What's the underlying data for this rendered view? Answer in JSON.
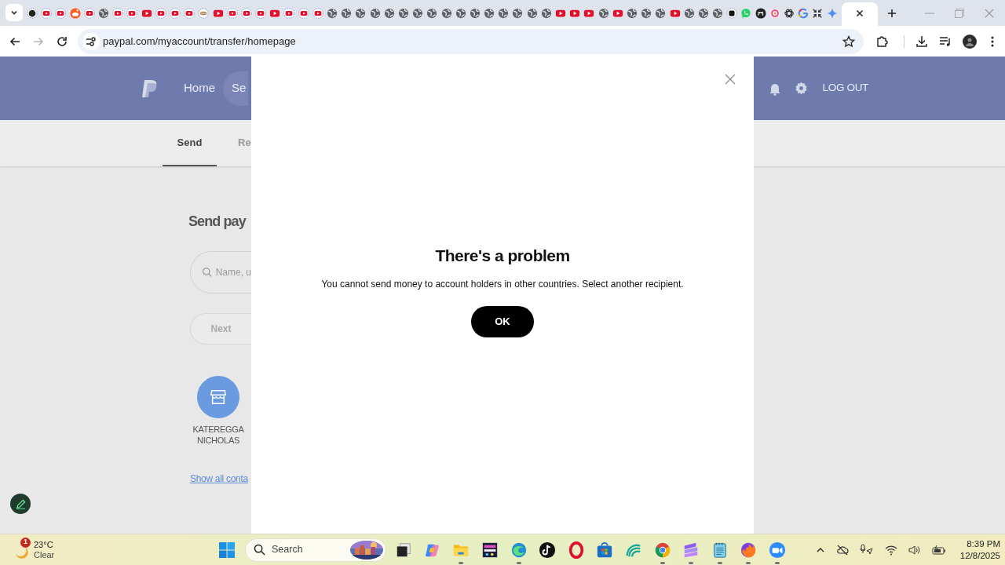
{
  "browser": {
    "tabs": [
      {
        "kind": "dark",
        "selected": false
      },
      {
        "kind": "ytc",
        "selected": false
      },
      {
        "kind": "ytc",
        "selected": false
      },
      {
        "kind": "mascot",
        "selected": false
      },
      {
        "kind": "ytc",
        "selected": false
      },
      {
        "kind": "globe",
        "selected": false
      },
      {
        "kind": "ytc",
        "selected": false
      },
      {
        "kind": "ytc",
        "selected": false
      },
      {
        "kind": "yt",
        "selected": false
      },
      {
        "kind": "ytc",
        "selected": false
      },
      {
        "kind": "ytc",
        "selected": false
      },
      {
        "kind": "ytc",
        "selected": false
      },
      {
        "kind": "oval",
        "selected": false
      },
      {
        "kind": "yt",
        "selected": false
      },
      {
        "kind": "ytc",
        "selected": false
      },
      {
        "kind": "ytc",
        "selected": false
      },
      {
        "kind": "ytc",
        "selected": false
      },
      {
        "kind": "yt",
        "selected": false
      },
      {
        "kind": "ytc",
        "selected": false
      },
      {
        "kind": "ytc",
        "selected": false
      },
      {
        "kind": "ytc",
        "selected": false
      },
      {
        "kind": "globe",
        "selected": false
      },
      {
        "kind": "globe",
        "selected": false
      },
      {
        "kind": "globe",
        "selected": false
      },
      {
        "kind": "globe",
        "selected": false
      },
      {
        "kind": "globe",
        "selected": false
      },
      {
        "kind": "globe",
        "selected": false
      },
      {
        "kind": "globe",
        "selected": false
      },
      {
        "kind": "globe",
        "selected": false
      },
      {
        "kind": "globe",
        "selected": false
      },
      {
        "kind": "globe",
        "selected": false
      },
      {
        "kind": "globe",
        "selected": false
      },
      {
        "kind": "globe",
        "selected": false
      },
      {
        "kind": "globe",
        "selected": false
      },
      {
        "kind": "globe",
        "selected": false
      },
      {
        "kind": "globe",
        "selected": false
      },
      {
        "kind": "globe",
        "selected": false
      },
      {
        "kind": "yt",
        "selected": false
      },
      {
        "kind": "yt",
        "selected": false
      },
      {
        "kind": "yt",
        "selected": false
      },
      {
        "kind": "globe",
        "selected": false
      },
      {
        "kind": "yt",
        "selected": false
      },
      {
        "kind": "globe",
        "selected": false
      },
      {
        "kind": "globe",
        "selected": false
      },
      {
        "kind": "globe",
        "selected": false
      },
      {
        "kind": "yt",
        "selected": false
      },
      {
        "kind": "globe",
        "selected": false
      },
      {
        "kind": "globe",
        "selected": false
      },
      {
        "kind": "globe",
        "selected": false
      },
      {
        "kind": "square",
        "selected": false
      },
      {
        "kind": "chat",
        "selected": false
      },
      {
        "kind": "mlogo",
        "selected": false
      },
      {
        "kind": "ring",
        "selected": false
      },
      {
        "kind": "knot",
        "selected": false
      },
      {
        "kind": "g",
        "selected": false
      },
      {
        "kind": "compress",
        "selected": false
      },
      {
        "kind": "sparkle",
        "selected": false
      },
      {
        "selected": true
      }
    ],
    "address": "paypal.com/myaccount/transfer/homepage",
    "forward_disabled": true
  },
  "paypal": {
    "nav": [
      {
        "label": "Home",
        "selected": false
      },
      {
        "label": "Se",
        "selected": true
      }
    ],
    "logout": "LOG OUT",
    "subtabs": [
      {
        "label": "Send",
        "selected": true
      },
      {
        "label": "Re",
        "selected": false
      }
    ],
    "heading": "Send pay",
    "search": {
      "placeholder": "Name, u"
    },
    "next": {
      "label": "Next",
      "disabled": true
    },
    "contacts": [
      {
        "name": "KATEREGGA NICHOLAS"
      }
    ],
    "show_all": "Show all conta"
  },
  "dialog": {
    "title": "There's a problem",
    "message": "You cannot send money to account holders in other countries. Select another recipient.",
    "button": "OK"
  },
  "taskbar": {
    "weather": {
      "temp": "23°C",
      "condition": "Clear",
      "badge": "1"
    },
    "search": {
      "placeholder": "Search"
    },
    "apps": [
      {
        "kind": "taskview",
        "running": false
      },
      {
        "kind": "swirl",
        "running": false
      },
      {
        "kind": "folder",
        "running": true
      },
      {
        "kind": "game",
        "running": false
      },
      {
        "kind": "wave",
        "running": true
      },
      {
        "kind": "note",
        "running": false
      },
      {
        "kind": "oring",
        "running": false
      },
      {
        "kind": "bag",
        "running": false
      },
      {
        "kind": "curl",
        "running": false
      },
      {
        "kind": "chrome",
        "running": true
      },
      {
        "kind": "stack",
        "running": true
      },
      {
        "kind": "notepad",
        "running": true
      },
      {
        "kind": "fox",
        "running": true
      },
      {
        "kind": "camera",
        "running": true
      }
    ],
    "clock": {
      "time": "8:39 PM",
      "date": "12/8/2025"
    }
  }
}
